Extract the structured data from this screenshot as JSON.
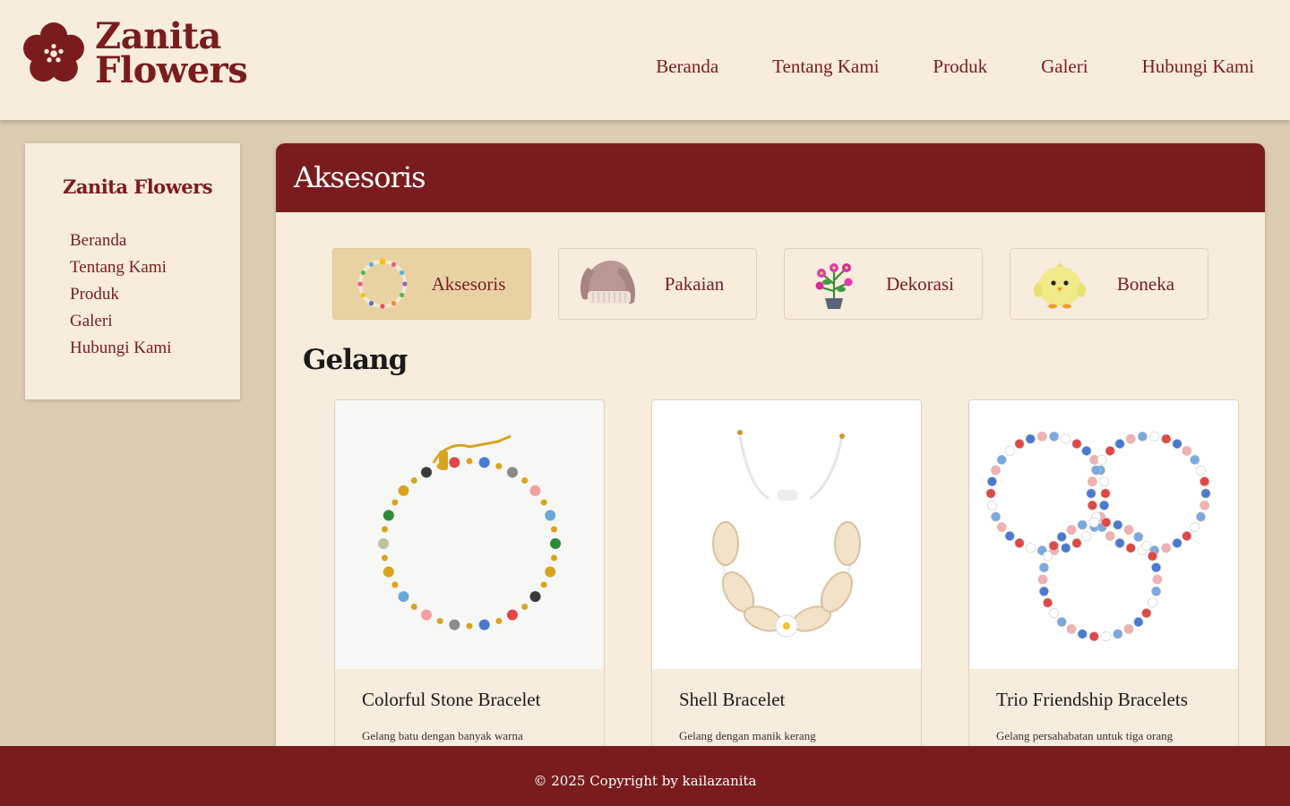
{
  "brand": {
    "line1": "Zanita",
    "line2": "Flowers",
    "accent": "#7a1c1e",
    "icon": "flower-logo-icon"
  },
  "topnav": [
    {
      "label": "Beranda"
    },
    {
      "label": "Tentang Kami"
    },
    {
      "label": "Produk"
    },
    {
      "label": "Galeri"
    },
    {
      "label": "Hubungi Kami"
    }
  ],
  "sidebar": {
    "title": "Zanita Flowers",
    "items": [
      {
        "label": "Beranda"
      },
      {
        "label": "Tentang Kami"
      },
      {
        "label": "Produk"
      },
      {
        "label": "Galeri"
      },
      {
        "label": "Hubungi Kami"
      }
    ]
  },
  "main": {
    "heading": "Aksesoris",
    "categories": [
      {
        "label": "Aksesoris",
        "icon": "bead-bracelet-icon",
        "active": true
      },
      {
        "label": "Pakaian",
        "icon": "knit-hat-icon",
        "active": false
      },
      {
        "label": "Dekorasi",
        "icon": "flower-pot-icon",
        "active": false
      },
      {
        "label": "Boneka",
        "icon": "chick-doll-icon",
        "active": false
      }
    ],
    "section": "Gelang",
    "products": [
      {
        "name": "Colorful Stone Bracelet",
        "desc": "Gelang batu dengan banyak warna",
        "image": "colorful-stone-bracelet-image"
      },
      {
        "name": "Shell Bracelet",
        "desc": "Gelang dengan manik kerang",
        "image": "shell-bracelet-image"
      },
      {
        "name": "Trio Friendship Bracelets",
        "desc": "Gelang persahabatan untuk tiga orang",
        "image": "trio-friendship-bracelets-image"
      }
    ]
  },
  "footer": {
    "text": "© 2025 Copyright by kailazanita"
  },
  "colors": {
    "header_bg": "#f8ecdc",
    "page_bg": "#dccdb1",
    "maroon": "#7a1c1e",
    "active_category": "#e8d2a4"
  }
}
